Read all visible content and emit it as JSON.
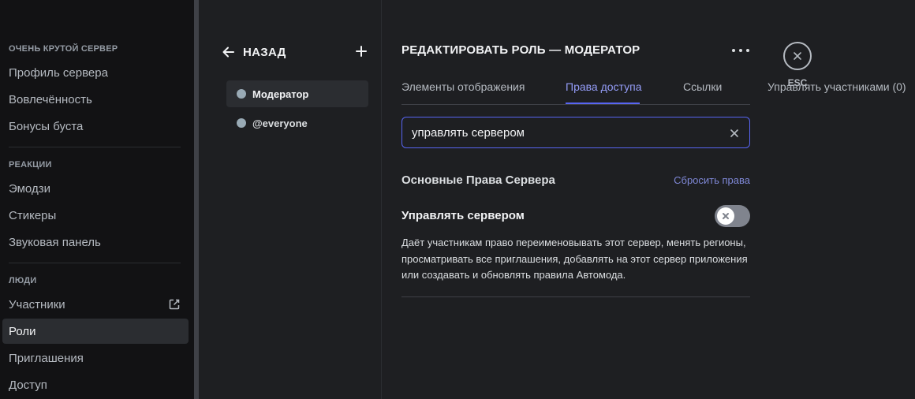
{
  "sidebar": {
    "sections": [
      {
        "header": "Очень крутой сервер",
        "items": [
          {
            "label": "Профиль сервера"
          },
          {
            "label": "Вовлечённость"
          },
          {
            "label": "Бонусы буста"
          }
        ]
      },
      {
        "header": "Реакции",
        "items": [
          {
            "label": "Эмодзи"
          },
          {
            "label": "Стикеры"
          },
          {
            "label": "Звуковая панель"
          }
        ]
      },
      {
        "header": "Люди",
        "items": [
          {
            "label": "Участники",
            "icon": "external-link-icon"
          },
          {
            "label": "Роли",
            "active": true
          },
          {
            "label": "Приглашения"
          },
          {
            "label": "Доступ"
          }
        ]
      }
    ]
  },
  "roles_panel": {
    "back_label": "НАЗАД",
    "add_icon": "plus-icon",
    "roles": [
      {
        "name": "Модератор",
        "color": "#99aab5",
        "active": true
      },
      {
        "name": "@everyone",
        "color": "#99aab5",
        "active": false
      }
    ]
  },
  "main": {
    "title": "РЕДАКТИРОВАТЬ РОЛЬ — МОДЕРАТОР",
    "tabs": [
      {
        "label": "Элементы отображения",
        "active": false
      },
      {
        "label": "Права доступа",
        "active": true
      },
      {
        "label": "Ссылки",
        "active": false
      },
      {
        "label": "Управлять участниками (0)",
        "active": false
      }
    ],
    "search": {
      "value": "управлять сервером",
      "placeholder": ""
    },
    "group_title": "Основные Права Сервера",
    "reset_label": "Сбросить права",
    "permission": {
      "title": "Управлять сервером",
      "description": "Даёт участникам право переименовывать этот сервер, менять регионы, просматривать все приглашения, добавлять на этот сервер приложения или создавать и обновлять правила Автомода.",
      "enabled": false
    }
  },
  "close": {
    "label": "ESC"
  },
  "colors": {
    "accent": "#5865f2",
    "accent_text": "#949cf7",
    "background": "#1e1f22",
    "sidebar": "#121214"
  }
}
